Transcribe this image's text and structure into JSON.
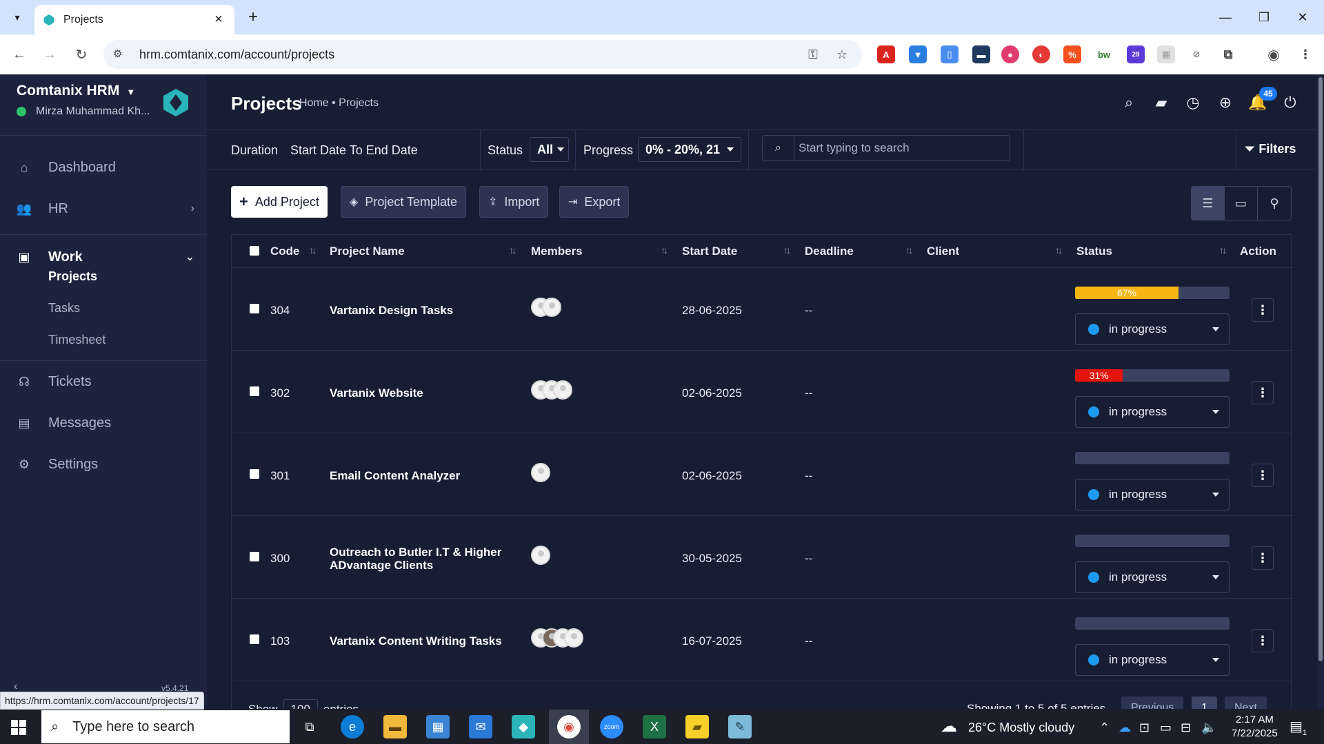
{
  "browser": {
    "tab_title": "Projects",
    "url": "hrm.comtanix.com/account/projects",
    "status_url": "https://hrm.comtanix.com/account/projects/17",
    "ext_badge": "29"
  },
  "sidebar": {
    "brand": "Comtanix HRM",
    "user": "Mirza Muhammad Kh...",
    "items": [
      {
        "label": "Dashboard"
      },
      {
        "label": "HR"
      },
      {
        "label": "Work"
      },
      {
        "label": "Tickets"
      },
      {
        "label": "Messages"
      },
      {
        "label": "Settings"
      }
    ],
    "work_sub": [
      "Projects",
      "Tasks",
      "Timesheet"
    ],
    "version": "v5.4.21"
  },
  "header": {
    "title": "Projects",
    "breadcrumb": "Home • Projects",
    "notif_count": "45"
  },
  "filters": {
    "duration_label": "Duration",
    "duration_value": "Start Date To End Date",
    "status_label": "Status",
    "status_value": "All",
    "progress_label": "Progress",
    "progress_value": "0% - 20%, 21",
    "search_placeholder": "Start typing to search",
    "filters_btn": "Filters"
  },
  "actions": {
    "add": "Add Project",
    "template": "Project Template",
    "import": "Import",
    "export": "Export"
  },
  "table": {
    "headers": [
      "Code",
      "Project Name",
      "Members",
      "Start Date",
      "Deadline",
      "Client",
      "Status",
      "Action"
    ],
    "rows": [
      {
        "code": "304",
        "name": "Vartanix Design Tasks",
        "members": 2,
        "start": "28-06-2025",
        "deadline": "--",
        "progress": 67,
        "progress_label": "67%",
        "progress_color": "#f5b614",
        "status": "in progress"
      },
      {
        "code": "302",
        "name": "Vartanix Website",
        "members": 3,
        "start": "02-06-2025",
        "deadline": "--",
        "progress": 31,
        "progress_label": "31%",
        "progress_color": "#e3140b",
        "status": "in progress"
      },
      {
        "code": "301",
        "name": "Email Content Analyzer",
        "members": 1,
        "start": "02-06-2025",
        "deadline": "--",
        "progress": 0,
        "progress_label": "",
        "progress_color": "#3a4262",
        "status": "in progress"
      },
      {
        "code": "300",
        "name": "Outreach to Butler I.T & Higher ADvantage Clients",
        "members": 1,
        "start": "30-05-2025",
        "deadline": "--",
        "progress": 0,
        "progress_label": "",
        "progress_color": "#3a4262",
        "status": "in progress"
      },
      {
        "code": "103",
        "name": "Vartanix Content Writing Tasks",
        "members": 4,
        "start": "16-07-2025",
        "deadline": "--",
        "progress": 0,
        "progress_label": "",
        "progress_color": "#3a4262",
        "status": "in progress"
      }
    ]
  },
  "footer": {
    "show": "Show",
    "entries_value": "100",
    "entries": "entries",
    "summary": "Showing 1 to 5 of 5 entries",
    "previous": "Previous",
    "page": "1",
    "next": "Next"
  },
  "taskbar": {
    "search_placeholder": "Type here to search",
    "weather": "26°C  Mostly cloudy",
    "time": "2:17 AM",
    "date": "7/22/2025",
    "notif": "1"
  }
}
